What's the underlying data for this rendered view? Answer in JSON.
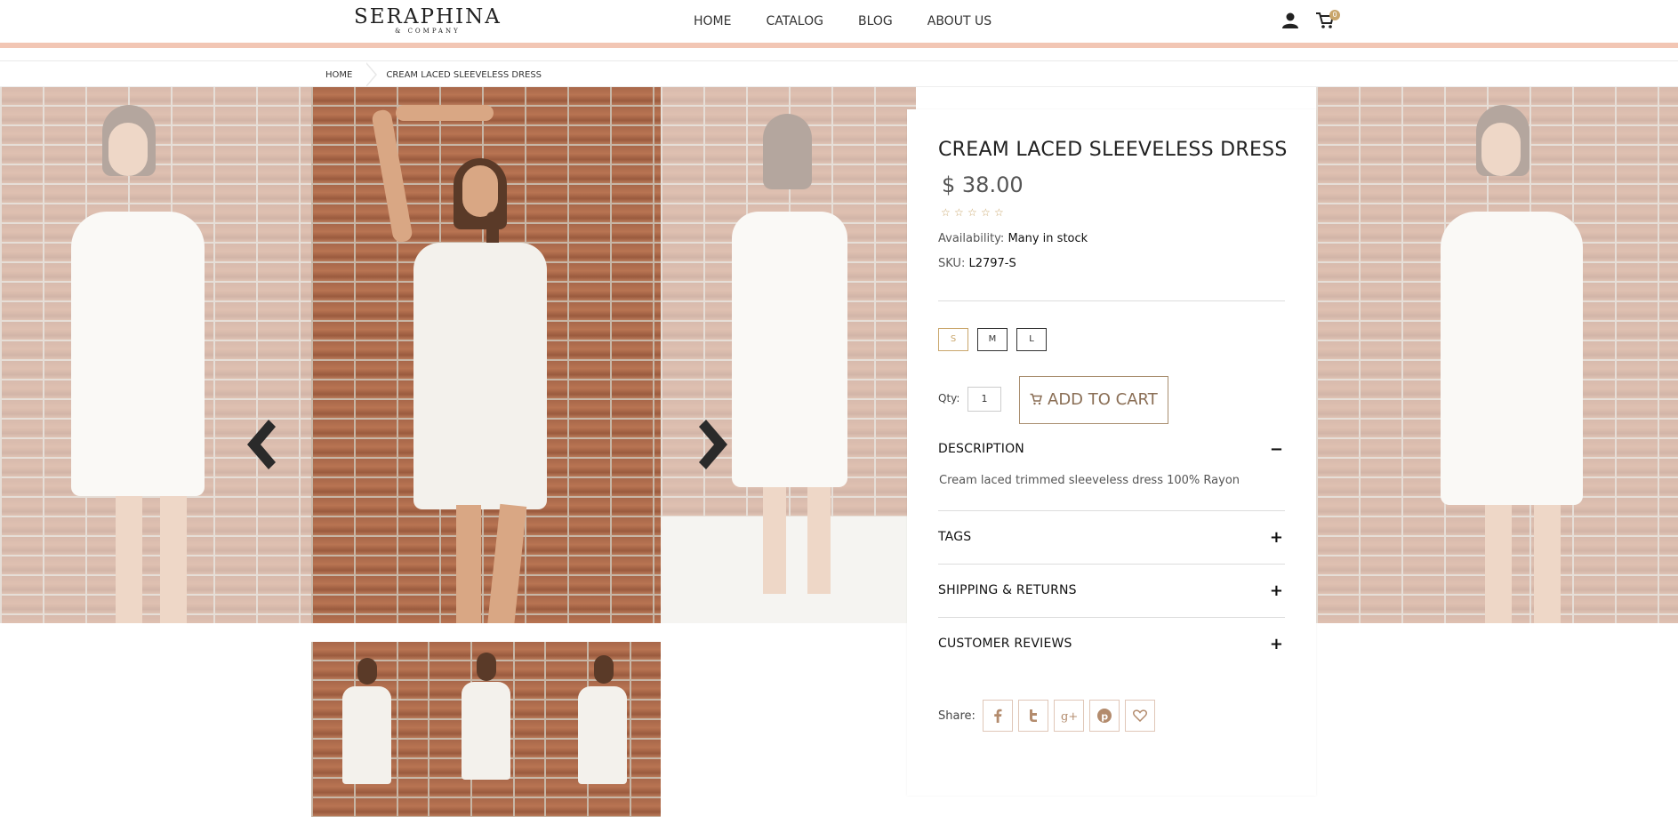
{
  "brand": {
    "name": "SERAPHINA",
    "tagline": "& COMPANY"
  },
  "nav": [
    {
      "label": "HOME"
    },
    {
      "label": "CATALOG"
    },
    {
      "label": "BLOG"
    },
    {
      "label": "ABOUT US"
    }
  ],
  "cart": {
    "count": "0"
  },
  "breadcrumb": {
    "home": "HOME",
    "current": "CREAM LACED SLEEVELESS DRESS"
  },
  "product": {
    "title": "CREAM LACED SLEEVELESS DRESS",
    "price": "$ 38.00",
    "rating_stars": 5,
    "rating_value": 0,
    "availability_label": "Availability:",
    "availability_value": "Many in stock",
    "sku_label": "SKU:",
    "sku_value": "L2797-S",
    "sizes": [
      "S",
      "M",
      "L"
    ],
    "selected_size": "S",
    "qty_label": "Qty:",
    "qty_value": "1",
    "add_to_cart": "ADD TO CART"
  },
  "accordion": {
    "description": {
      "label": "DESCRIPTION",
      "sign": "−",
      "text": "Cream laced trimmed sleeveless dress 100% Rayon"
    },
    "tags": {
      "label": "TAGS",
      "sign": "+"
    },
    "shipping": {
      "label": "SHIPPING & RETURNS",
      "sign": "+"
    },
    "reviews": {
      "label": "CUSTOMER REVIEWS",
      "sign": "+"
    }
  },
  "share": {
    "label": "Share:",
    "icons": [
      "facebook-icon",
      "twitter-icon",
      "google-plus-icon",
      "pinterest-icon",
      "heart-icon"
    ]
  },
  "colors": {
    "accent": "#c9a66b",
    "accent_bar": "#f2c6b4",
    "button_border": "#a98e6f"
  }
}
